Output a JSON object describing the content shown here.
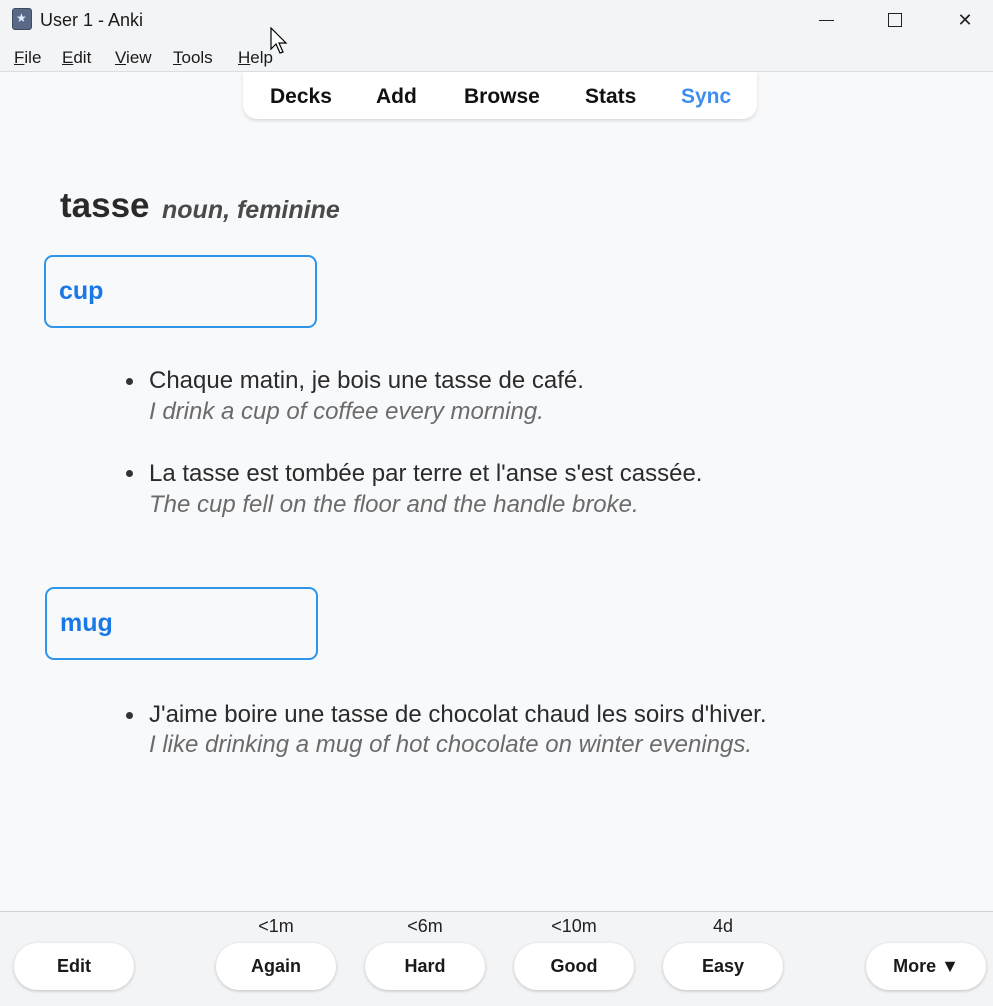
{
  "window": {
    "title": "User 1 - Anki",
    "minimize_glyph": "minimize-icon",
    "maximize_glyph": "maximize-icon",
    "close_glyph": "✕"
  },
  "menu": {
    "items": [
      {
        "underline": "F",
        "rest": "ile"
      },
      {
        "underline": "E",
        "rest": "dit"
      },
      {
        "underline": "V",
        "rest": "iew"
      },
      {
        "underline": "T",
        "rest": "ools"
      },
      {
        "underline": "H",
        "rest": "elp"
      }
    ]
  },
  "toolbar": {
    "decks": "Decks",
    "add": "Add",
    "browse": "Browse",
    "stats": "Stats",
    "sync": "Sync",
    "sync_color": "#3d8ef0"
  },
  "card": {
    "word": "tasse",
    "part_of_speech": "noun, feminine",
    "meanings": [
      {
        "label": "cup",
        "examples": [
          {
            "fr": "Chaque matin, je bois une tasse de café.",
            "en": "I drink a cup of coffee every morning."
          },
          {
            "fr": "La tasse est tombée par terre et l'anse s'est cassée.",
            "en": "The cup fell on the floor and the handle broke."
          }
        ]
      },
      {
        "label": "mug",
        "examples": [
          {
            "fr": "J'aime boire une tasse de chocolat chaud les soirs d'hiver.",
            "en": "I like drinking a mug of hot chocolate on winter evenings."
          }
        ]
      }
    ],
    "accent_color": "#1a78e6",
    "box_border_color": "#2f95e8"
  },
  "bottom": {
    "edit": "Edit",
    "answers": [
      {
        "interval": "<1m",
        "label": "Again"
      },
      {
        "interval": "<6m",
        "label": "Hard"
      },
      {
        "interval": "<10m",
        "label": "Good"
      },
      {
        "interval": "4d",
        "label": "Easy"
      }
    ],
    "more": "More ▼"
  }
}
